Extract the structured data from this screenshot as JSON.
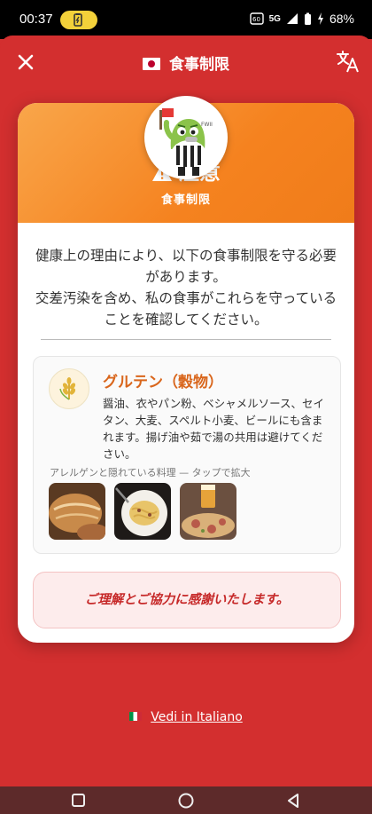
{
  "status_bar": {
    "time": "00:37",
    "network": "5G",
    "battery_percent": "68%"
  },
  "header": {
    "title": "食事制限",
    "close_icon": "close-icon",
    "translate_icon": "translate-icon"
  },
  "card": {
    "warning_title": "注意",
    "warning_subtitle": "食事制限",
    "intro_line1": "健康上の理由により、以下の食事制限を守る必要があります。",
    "intro_line2": "交差汚染を含め、私の食事がこれらを守っていることを確認してください。",
    "allergen": {
      "name": "グルテン（穀物）",
      "description": "醤油、衣やパン粉、ベシャメルソース、セイタン、大麦、スペルト小麦、ビールにも含まれます。揚げ油や茹で湯の共用は避けてください。",
      "hidden_label": "アレルゲンと隠れている料理 — タップで拡大"
    },
    "thanks": "ご理解とご協力に感謝いたします。"
  },
  "footer": {
    "language_link": "Vedi in Italiano"
  },
  "colors": {
    "background": "#d32f2f",
    "header_gradient_start": "#f9a64a",
    "header_gradient_end": "#f07c1a",
    "allergen_name": "#d9661c",
    "thanks_text": "#c62828"
  }
}
